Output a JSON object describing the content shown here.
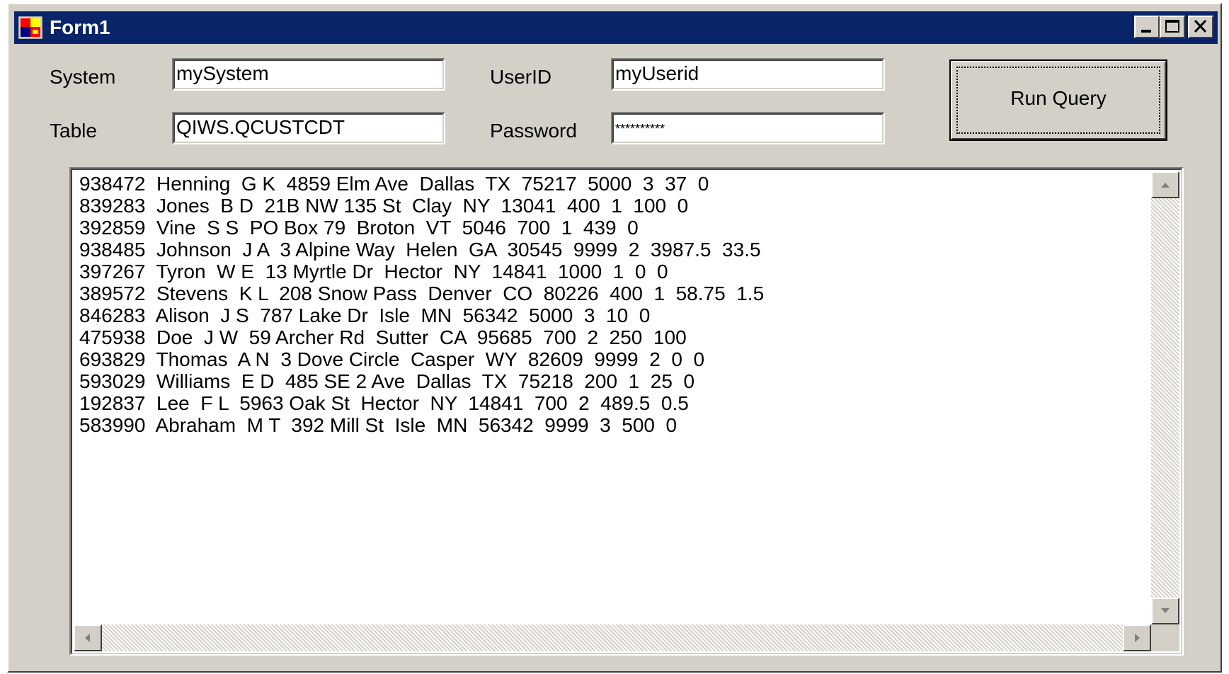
{
  "window": {
    "title": "Form1",
    "controls": {
      "minimize": "minimize-icon",
      "maximize": "maximize-icon",
      "close": "close-icon"
    }
  },
  "form": {
    "system_label": "System",
    "system_value": "mySystem",
    "userid_label": "UserID",
    "userid_value": "myUserid",
    "table_label": "Table",
    "table_value": "QIWS.QCUSTCDT",
    "password_label": "Password",
    "password_value": "**********",
    "run_button": "Run Query"
  },
  "results": [
    "938472  Henning  G K  4859 Elm Ave  Dallas  TX  75217  5000  3  37  0",
    "839283  Jones  B D  21B NW 135 St  Clay  NY  13041  400  1  100  0",
    "392859  Vine  S S  PO Box 79  Broton  VT  5046  700  1  439  0",
    "938485  Johnson  J A  3 Alpine Way  Helen  GA  30545  9999  2  3987.5  33.5",
    "397267  Tyron  W E  13 Myrtle Dr  Hector  NY  14841  1000  1  0  0",
    "389572  Stevens  K L  208 Snow Pass  Denver  CO  80226  400  1  58.75  1.5",
    "846283  Alison  J S  787 Lake Dr  Isle  MN  56342  5000  3  10  0",
    "475938  Doe  J W  59 Archer Rd  Sutter  CA  95685  700  2  250  100",
    "693829  Thomas  A N  3 Dove Circle  Casper  WY  82609  9999  2  0  0",
    "593029  Williams  E D  485 SE 2 Ave  Dallas  TX  75218  200  1  25  0",
    "192837  Lee  F L  5963 Oak St  Hector  NY  14841  700  2  489.5  0.5",
    "583990  Abraham  M T  392 Mill St  Isle  MN  56342  9999  3  500  0"
  ],
  "colors": {
    "titlebar": "#0a246a",
    "face": "#d4d0c8"
  }
}
